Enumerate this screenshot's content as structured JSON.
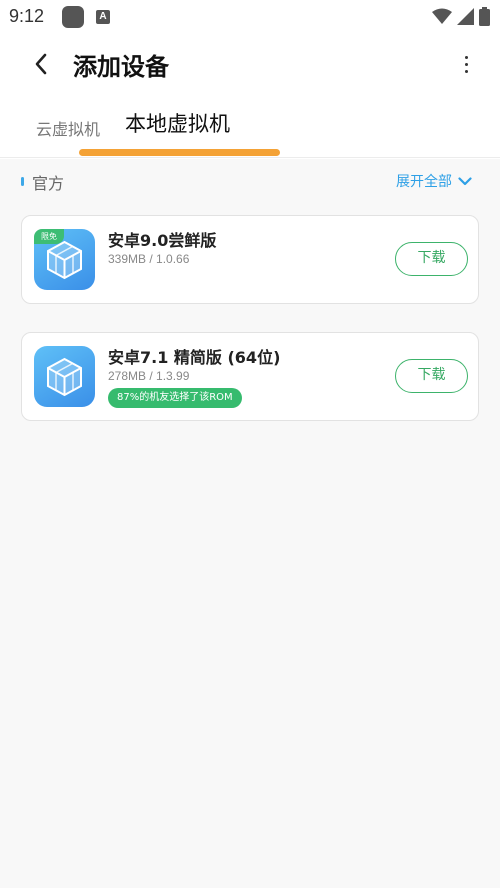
{
  "status_bar": {
    "time": "9:12",
    "icons": [
      "app-square-icon",
      "a-badge-icon",
      "wifi-icon",
      "signal-icon",
      "battery-icon"
    ]
  },
  "header": {
    "title": "添加设备",
    "back_icon": "chevron-left-icon",
    "more_icon": "more-vertical-icon"
  },
  "tabs": [
    {
      "label": "云虚拟机",
      "active": false
    },
    {
      "label": "本地虚拟机",
      "active": true
    }
  ],
  "section": {
    "title": "官方",
    "expand_label": "展开全部",
    "expand_icon": "chevron-down-icon"
  },
  "roms": [
    {
      "name": "安卓9.0尝鲜版",
      "meta": "339MB / 1.0.66",
      "badge": "限免",
      "tag": null,
      "button": "下载",
      "icon": "vm-cube-icon"
    },
    {
      "name": "安卓7.1 精简版 (64位)",
      "meta": "278MB / 1.3.99",
      "badge": null,
      "tag": "87%的机友选择了该ROM",
      "button": "下载",
      "icon": "vm-cube-icon"
    }
  ],
  "colors": {
    "accent_orange": "#f4a236",
    "link_blue": "#2ea0e6",
    "download_green": "#3db36b",
    "tag_green": "#36bb6e"
  }
}
